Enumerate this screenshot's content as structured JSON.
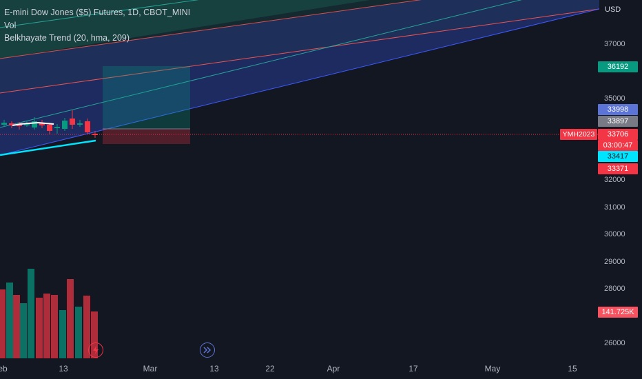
{
  "legend": {
    "symbol_line": "E-mini Dow Jones ($5) Futures, 1D, CBOT_MINI",
    "vol_label": "Vol",
    "indicator": "Belkhayate Trend (20, hma, 209)"
  },
  "price_axis": {
    "currency": "USD",
    "ticks": [
      {
        "label": "37000",
        "value": 37000
      },
      {
        "label": "35000",
        "value": 35000
      },
      {
        "label": "32000",
        "value": 32000
      },
      {
        "label": "31000",
        "value": 31000
      },
      {
        "label": "30000",
        "value": 30000
      },
      {
        "label": "29000",
        "value": 29000
      },
      {
        "label": "28000",
        "value": 28000
      },
      {
        "label": "26000",
        "value": 26000
      }
    ]
  },
  "badges": {
    "target": {
      "label": "36192",
      "color": "#089981"
    },
    "upper_band": {
      "label": "33998",
      "color": "#5b74d6"
    },
    "entry": {
      "label": "33897",
      "color": "#787b86"
    },
    "last_price": {
      "label": "33706",
      "color": "#f23645"
    },
    "countdown": {
      "label": "03:00:47",
      "color": "#f23645"
    },
    "trend_line": {
      "label": "33417",
      "color": "#00e5ff"
    },
    "stop": {
      "label": "33371",
      "color": "#f23645"
    },
    "volume": {
      "label": "141.725K",
      "color": "#f7525f"
    }
  },
  "symbol_tag": "YMH2023",
  "time_axis": {
    "labels": [
      {
        "label": "eb"
      },
      {
        "label": "13"
      },
      {
        "label": "Mar"
      },
      {
        "label": "13"
      },
      {
        "label": "22"
      },
      {
        "label": "Apr"
      },
      {
        "label": "17"
      },
      {
        "label": "May"
      },
      {
        "label": "15"
      }
    ]
  },
  "icons": {
    "lightning": "lightning-icon",
    "fast_forward": "fast-forward-icon"
  },
  "colors": {
    "background": "#131722",
    "up": "#089981",
    "down": "#f23645",
    "trend": "#00e5ff",
    "channel_blue": "#3d5afe",
    "channel_green": "#26a69a",
    "channel_red": "#ef5350"
  },
  "chart_data": {
    "type": "candlestick",
    "volume_bars_visible": true,
    "candles_visible_count": 12,
    "last_price": 33706
  }
}
